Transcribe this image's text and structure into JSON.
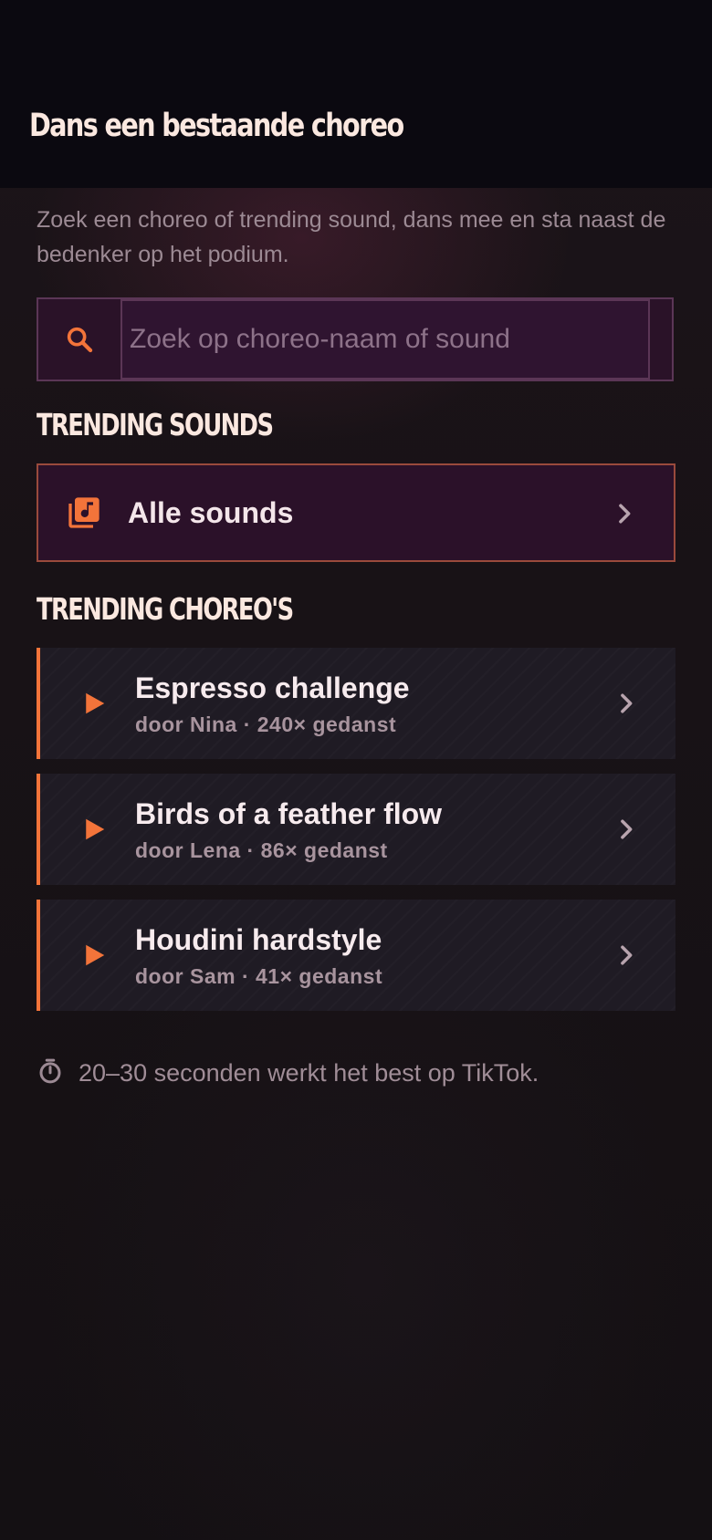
{
  "header": {
    "title": "Dans een bestaande choreo"
  },
  "intro": {
    "text": "Zoek een choreo of trending sound, dans mee en sta naast de bedenker op het podium."
  },
  "search": {
    "placeholder": "Zoek op choreo-naam of sound",
    "value": "",
    "icon": "search-icon"
  },
  "trending_sounds": {
    "heading": "TRENDING SOUNDS",
    "all_sounds_label": "Alle sounds",
    "icon": "music-library-icon"
  },
  "trending_choreos": {
    "heading": "TRENDING CHOREO'S",
    "items": [
      {
        "title": "Espresso challenge",
        "meta": "door Nina · 240× gedanst"
      },
      {
        "title": "Birds of a feather flow",
        "meta": "door Lena · 86× gedanst"
      },
      {
        "title": "Houdini hardstyle",
        "meta": "door Sam · 41× gedanst"
      }
    ]
  },
  "tip": {
    "text": "20–30 seconden werkt het best op TikTok.",
    "icon": "timer-icon"
  },
  "colors": {
    "accent": "#f3743a",
    "background": "#141016",
    "header_bg": "#0b0910",
    "panel": "#2b1129"
  }
}
